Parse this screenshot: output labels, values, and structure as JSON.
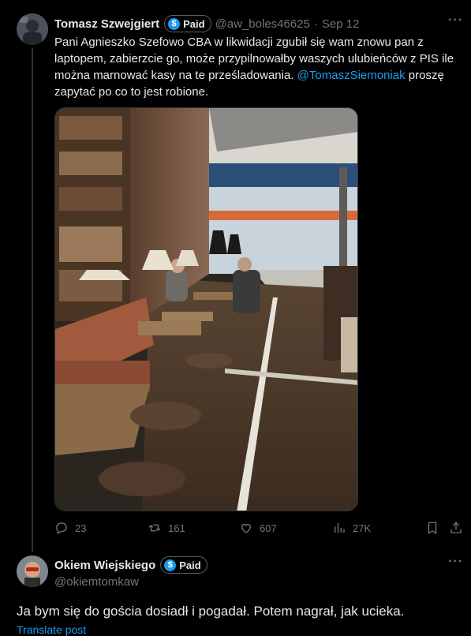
{
  "tweet": {
    "author_name": "Tomasz Szwejgiert",
    "badge": "Paid",
    "handle": "@aw_boles46625",
    "separator": "·",
    "date": "Sep 12",
    "more": "···",
    "text_part1": "Pani Agnieszko Szefowo CBA w likwidacji zgubił się wam znowu pan z laptopem, zabierzcie go, może przypilnowałby waszych ulubieńców z PIS ile można marnować kasy na te prześladowania. ",
    "mention": "@TomaszSiemoniak",
    "text_part2": " proszę zapytać po co to jest robione.",
    "stats": {
      "replies": "23",
      "reposts": "161",
      "likes": "607",
      "views": "27K"
    }
  },
  "reply": {
    "author_name": "Okiem Wiejskiego",
    "badge": "Paid",
    "handle": "@okiemtomkaw",
    "more": "···",
    "text": "Ja bym się do gościa dosiadł i pogadał. Potem nagrał, jak ucieka.",
    "translate": "Translate post"
  },
  "colors": {
    "background": "#000000",
    "text": "#e7e9ea",
    "muted": "#71767b",
    "accent": "#1d9bf0"
  }
}
